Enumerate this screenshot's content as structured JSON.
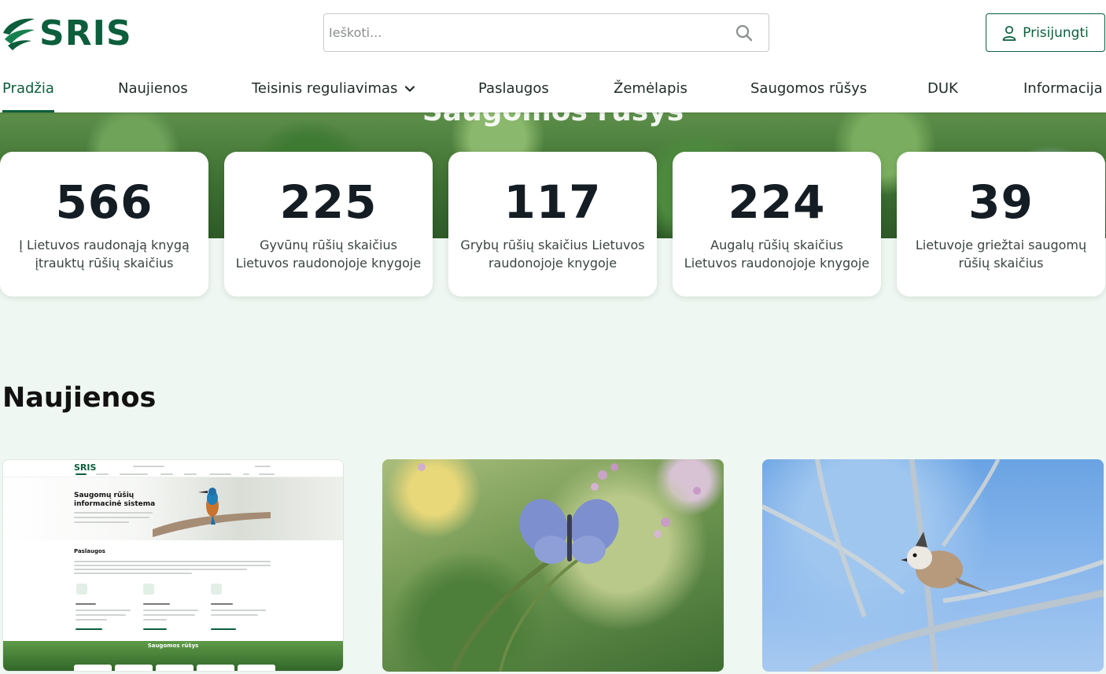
{
  "header": {
    "logo_text": "SRIS",
    "search_placeholder": "Ieškoti...",
    "login_label": "Prisijungti"
  },
  "nav": {
    "items": [
      {
        "label": "Pradžia",
        "active": true
      },
      {
        "label": "Naujienos"
      },
      {
        "label": "Teisinis reguliavimas",
        "has_dropdown": true
      },
      {
        "label": "Paslaugos"
      },
      {
        "label": "Žemėlapis"
      },
      {
        "label": "Saugomos rūšys"
      },
      {
        "label": "DUK"
      },
      {
        "label": "Informacija"
      }
    ]
  },
  "hero": {
    "title": "Saugomos rūšys"
  },
  "stats": [
    {
      "value": "566",
      "label": "Į Lietuvos raudonąją knygą įtrauktų rūšių skaičius"
    },
    {
      "value": "225",
      "label": "Gyvūnų rūšių skaičius Lietuvos raudonojoje knygoje"
    },
    {
      "value": "117",
      "label": "Grybų rūšių skaičius Lietuvos raudonojoje knygoje"
    },
    {
      "value": "224",
      "label": "Augalų rūšių skaičius Lietuvos raudonojoje knygoje"
    },
    {
      "value": "39",
      "label": "Lietuvoje griežtai saugomų rūšių skaičius"
    }
  ],
  "news": {
    "heading": "Naujienos",
    "preview": {
      "logo_text": "SRIS",
      "hero_title": "Saugomų rūšių informacinė sistema",
      "section_title": "Paslaugos",
      "footer_title": "Saugomos rūšys"
    }
  },
  "colors": {
    "brand": "#0c5e3c",
    "background": "#eef7f1",
    "card": "#ffffff",
    "text_dark": "#141c24"
  }
}
